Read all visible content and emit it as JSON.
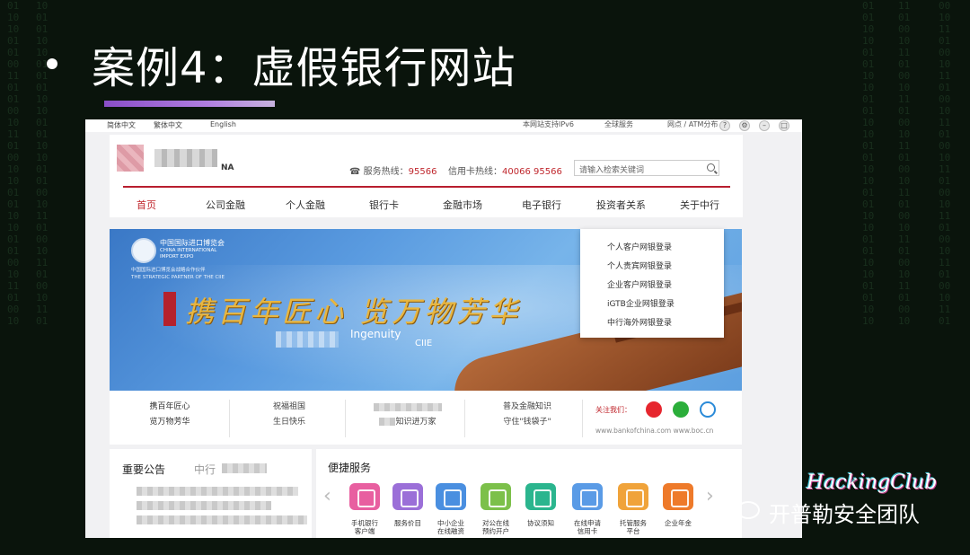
{
  "slide": {
    "title": "案例4：虚假银行网站"
  },
  "topbar": {
    "languages": [
      "简体中文",
      "繁体中文",
      "English"
    ],
    "ipv6": "本网站支持IPv6",
    "global": "全球服务",
    "atm": "网点 / ATM分布"
  },
  "header": {
    "logo_suffix": "NA",
    "service_hotline_label": "服务热线：",
    "service_hotline": "95566",
    "card_hotline_label": "信用卡热线：",
    "card_hotline": "40066 95566",
    "search_placeholder": "请输入检索关键词"
  },
  "nav": [
    "首页",
    "公司金融",
    "个人金融",
    "银行卡",
    "金融市场",
    "电子银行",
    "投资者关系",
    "关于中行"
  ],
  "banner": {
    "expo_cn": "中国国际进口博览会",
    "expo_en_1": "CHINA INTERNATIONAL",
    "expo_en_2": "IMPORT EXPO",
    "expo_sub_1": "中国国际进口博览会战略合作伙伴",
    "expo_sub_2": "THE STRATEGIC PARTNER OF THE CIIE",
    "slogan": "携百年匠心   览万物芳华",
    "en_text": "Ingenuity",
    "cie_text": "CIIE"
  },
  "login_menu": [
    "个人客户网银登录",
    "个人贵宾网银登录",
    "企业客户网银登录",
    "iGTB企业网银登录",
    "中行海外网银登录"
  ],
  "strip": {
    "cells": [
      {
        "line1": "携百年匠心",
        "line2": "览万物芳华"
      },
      {
        "line1": "祝福祖国",
        "line2": "生日快乐"
      },
      {
        "line1": "",
        "line2": "知识进万家"
      },
      {
        "line1": "普及金融知识",
        "line2": "守住\"钱袋子\""
      }
    ],
    "follow_label": "关注我们：",
    "urls": "www.bankofchina.com   www.boc.cn"
  },
  "notice": {
    "title": "重要公告",
    "tab2": "中行"
  },
  "services": {
    "title": "便捷服务",
    "items": [
      {
        "label1": "手机银行",
        "label2": "客户端",
        "color": "#e85fa0"
      },
      {
        "label1": "服务价目",
        "label2": "",
        "color": "#9b6fd8"
      },
      {
        "label1": "中小企业",
        "label2": "在线融资",
        "color": "#4a8fe0"
      },
      {
        "label1": "对公在线",
        "label2": "预约开户",
        "color": "#7cc04a"
      },
      {
        "label1": "协议须知",
        "label2": "",
        "color": "#2bb58e"
      },
      {
        "label1": "在线申请",
        "label2": "信用卡",
        "color": "#5a9be6"
      },
      {
        "label1": "托管服务",
        "label2": "平台",
        "color": "#f0a33a"
      },
      {
        "label1": "企业年金",
        "label2": "",
        "color": "#ee7a2a"
      }
    ]
  },
  "watermark": {
    "logo": "HackingClub",
    "team": "开普勒安全团队"
  }
}
